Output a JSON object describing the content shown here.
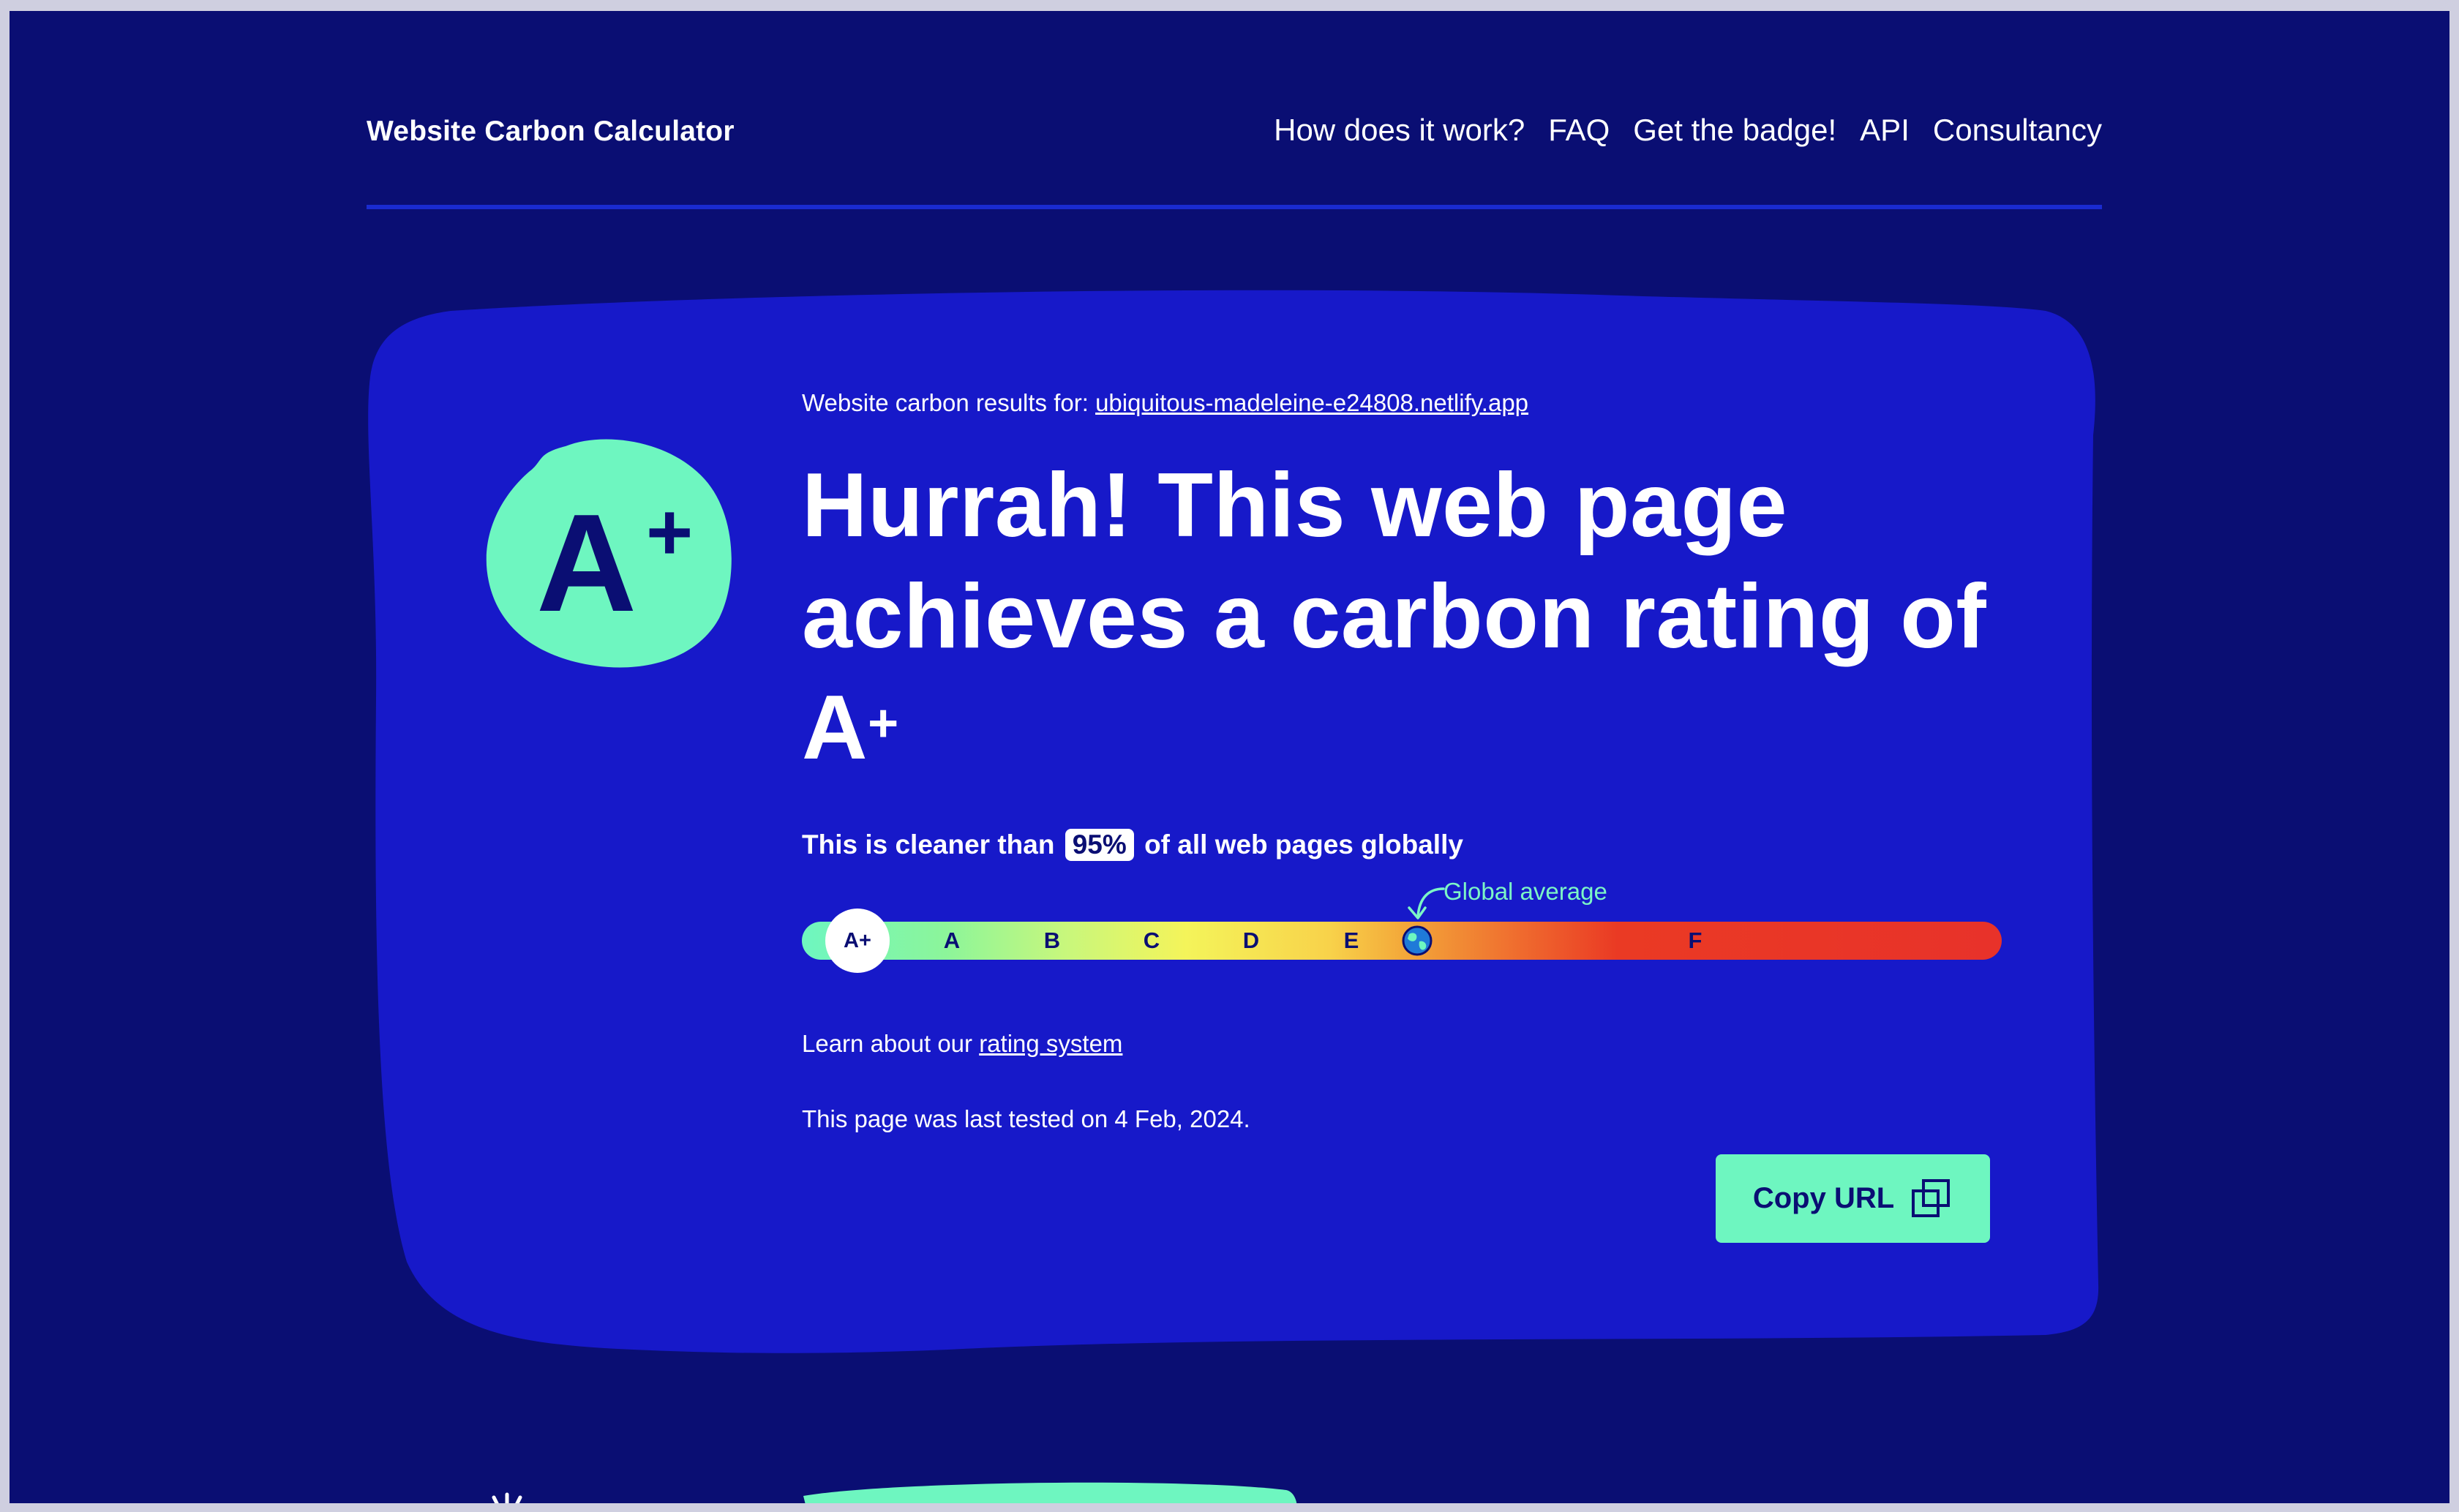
{
  "header": {
    "brand": "Website Carbon Calculator",
    "nav": [
      "How does it work?",
      "FAQ",
      "Get the badge!",
      "API",
      "Consultancy"
    ]
  },
  "results": {
    "prefix": "Website carbon results for: ",
    "url": "ubiquitous-madeleine-e24808.netlify.app",
    "badge_letter": "A",
    "badge_sup": "+",
    "headline_line1": "Hurrah! This web page",
    "headline_line2": "achieves a carbon rating of",
    "headline_grade": "A",
    "headline_grade_sup": "+",
    "cleaner_prefix": "This is cleaner than",
    "cleaner_percent": "95%",
    "cleaner_suffix": "of all web pages globally",
    "global_average_label": "Global average",
    "scale_current": "A+",
    "scale_letters": [
      "A",
      "B",
      "C",
      "D",
      "E",
      "F"
    ],
    "learn_prefix": "Learn about our ",
    "learn_link": "rating system",
    "tested": "This page was last tested on 4 Feb, 2024.",
    "copy_button": "Copy URL"
  },
  "colors": {
    "page_bg": "#0a0e73",
    "card_bg": "#1719c9",
    "accent_green": "#6ef6c0",
    "scale_red": "#e8322a"
  },
  "icons": [
    "copy-icon",
    "globe-icon",
    "curved-arrow-icon"
  ]
}
